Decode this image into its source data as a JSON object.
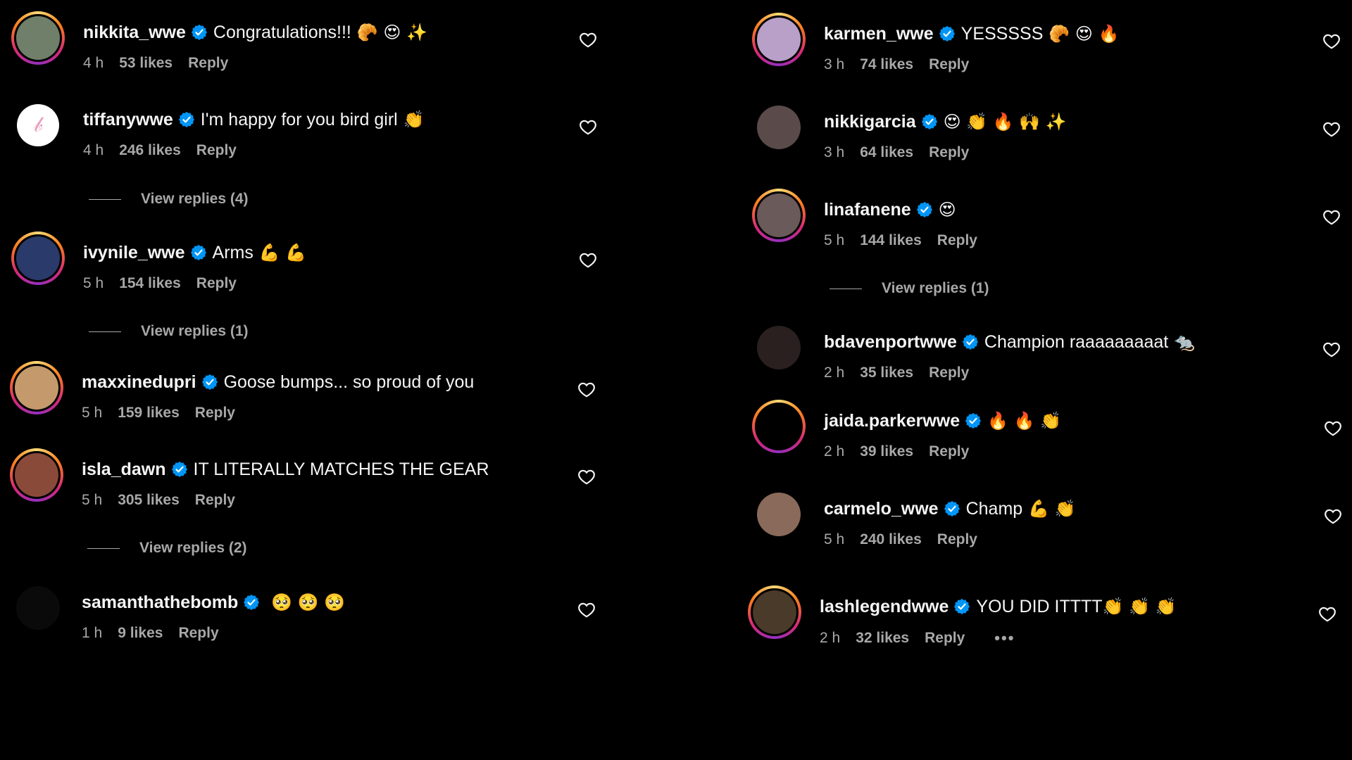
{
  "left": [
    {
      "user": "nikkita_wwe",
      "text": "Congratulations!!!",
      "emoji": "🥐 😍 ✨",
      "time": "4 h",
      "likes": "53 likes",
      "reply": "Reply",
      "avatar_color": "#6f7f6a"
    },
    {
      "user": "tiffanywwe",
      "text": "I'm happy for you bird girl",
      "emoji": "👏",
      "time": "4 h",
      "likes": "246 likes",
      "reply": "Reply",
      "avatar_color": "#ffffff",
      "replies": "View replies (4)"
    },
    {
      "user": "ivynile_wwe",
      "text": "Arms",
      "emoji": "💪 💪",
      "time": "5 h",
      "likes": "154 likes",
      "reply": "Reply",
      "avatar_color": "#2a3a6a",
      "replies": "View replies (1)"
    },
    {
      "user": "maxxinedupri",
      "text": "Goose bumps... so proud of you",
      "emoji": "",
      "time": "5 h",
      "likes": "159 likes",
      "reply": "Reply",
      "avatar_color": "#c49a6c"
    },
    {
      "user": "isla_dawn",
      "text": "IT LITERALLY MATCHES THE GEAR",
      "emoji": "",
      "time": "5 h",
      "likes": "305 likes",
      "reply": "Reply",
      "avatar_color": "#8a4a3a",
      "replies": "View replies (2)"
    },
    {
      "user": "samanthathebomb",
      "text": "",
      "emoji": "🥺 🥺 🥺",
      "time": "1 h",
      "likes": "9 likes",
      "reply": "Reply",
      "avatar_color": "#0a0a0a"
    }
  ],
  "right": [
    {
      "user": "karmen_wwe",
      "text": "YESSSSS",
      "emoji": "🥐 😍 🔥",
      "time": "3 h",
      "likes": "74 likes",
      "reply": "Reply",
      "avatar_color": "#b8a0c8"
    },
    {
      "user": "nikkigarcia",
      "text": "",
      "emoji": "😍 👏 🔥 🙌 ✨",
      "time": "3 h",
      "likes": "64 likes",
      "reply": "Reply",
      "avatar_color": "#5a4a4a"
    },
    {
      "user": "linafanene",
      "text": "",
      "emoji": "😍",
      "time": "5 h",
      "likes": "144 likes",
      "reply": "Reply",
      "avatar_color": "#6a5a5a",
      "replies": "View replies (1)"
    },
    {
      "user": "bdavenportwwe",
      "text": "Champion raaaaaaaaat",
      "emoji": "🐀",
      "time": "2 h",
      "likes": "35 likes",
      "reply": "Reply",
      "avatar_color": "#2a2020"
    },
    {
      "user": "jaida.parkerwwe",
      "text": "",
      "emoji": "🔥 🔥 👏",
      "time": "2 h",
      "likes": "39 likes",
      "reply": "Reply",
      "avatar_color": "#000000"
    },
    {
      "user": "carmelo_wwe",
      "text": "Champ",
      "emoji": "💪 👏",
      "time": "5 h",
      "likes": "240 likes",
      "reply": "Reply",
      "avatar_color": "#8a6a5a"
    },
    {
      "user": "lashlegendwwe",
      "text": "YOU DID ITTTT",
      "emoji": "👏 👏 👏",
      "time": "2 h",
      "likes": "32 likes",
      "reply": "Reply",
      "avatar_color": "#4a3a2a",
      "more": "•••"
    }
  ],
  "colors": {
    "verified": "#0095f6",
    "muted": "#a8a8a8",
    "text": "#f5f5f5",
    "background": "#000000"
  },
  "icons": {
    "verified": "verified-badge-icon",
    "like": "heart-outline-icon"
  }
}
